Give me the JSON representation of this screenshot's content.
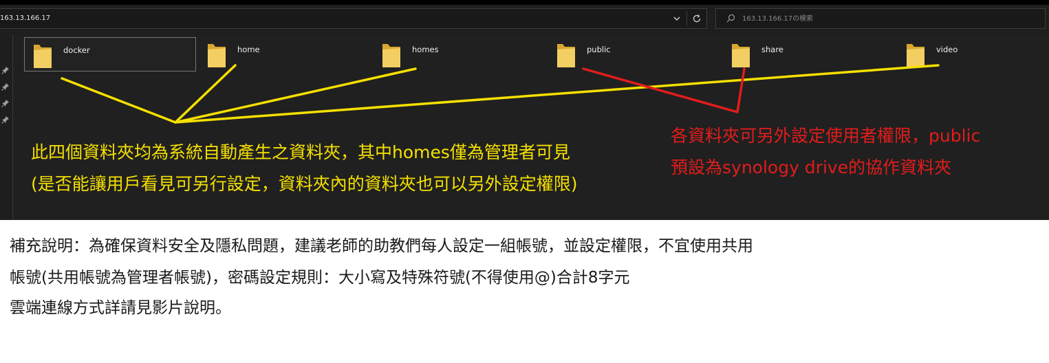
{
  "explorer": {
    "address": "163.13.166.17",
    "search_placeholder": "163.13.166.17の検索",
    "folders": [
      {
        "name": "docker",
        "selected": true
      },
      {
        "name": "home",
        "selected": false
      },
      {
        "name": "homes",
        "selected": false
      },
      {
        "name": "public",
        "selected": false
      },
      {
        "name": "share",
        "selected": false
      },
      {
        "name": "video",
        "selected": false
      }
    ]
  },
  "annotations": {
    "yellow_color": "#f5e000",
    "red_color": "#e21c1c",
    "yellow_note": [
      "此四個資料夾均為系統自動產生之資料夾，其中homes僅為管理者可見",
      "(是否能讓用戶看見可另行設定，資料夾內的資料夾也可以另外設定權限)"
    ],
    "red_note": [
      "各資料夾可另外設定使用者權限，public",
      "預設為synology drive的協作資料夾"
    ]
  },
  "supplement": [
    "補充說明：為確保資料安全及隱私問題，建議老師的助教們每人設定一組帳號，並設定權限，不宜使用共用",
    "帳號(共用帳號為管理者帳號)，密碼設定規則：大小寫及特殊符號(不得使用@)合計8字元",
    "雲端連線方式詳請見影片說明。"
  ]
}
